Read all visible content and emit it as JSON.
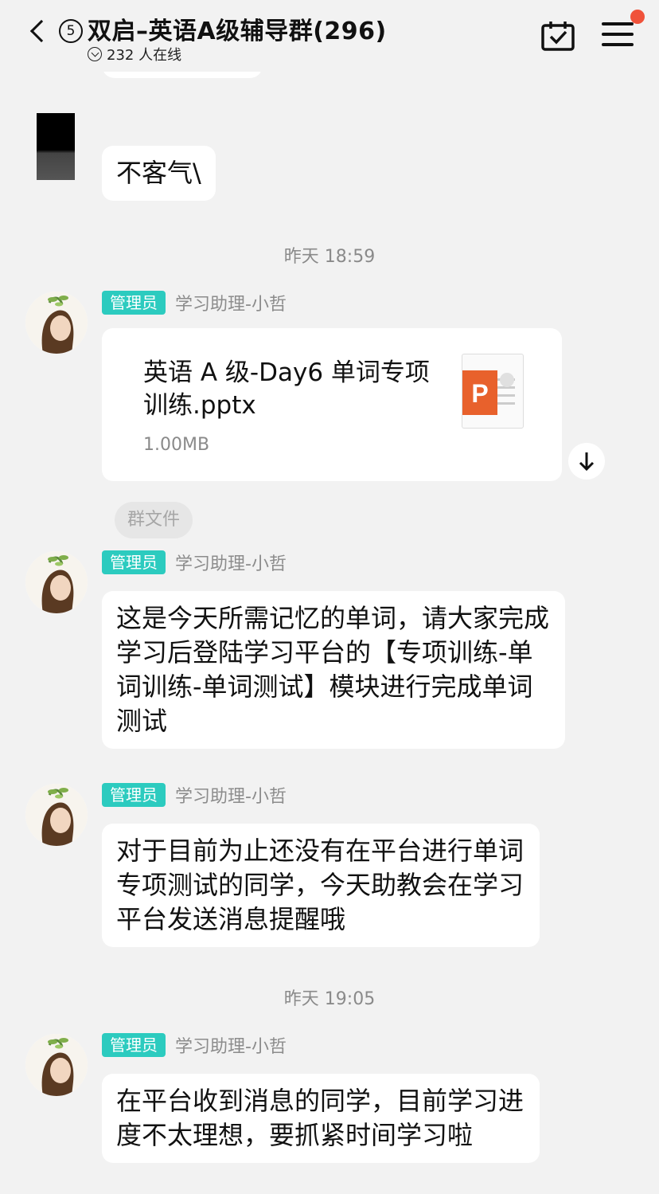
{
  "header": {
    "unread_count": "5",
    "group_title": "双启–英语A级辅导群(296)",
    "online_text": "232 人在线"
  },
  "messages": {
    "m1_text": "不客气\\",
    "time1": "昨天 18:59",
    "admin_badge": "管理员",
    "sender_name": "学习助理-小哲",
    "file_name": "英语 A 级-Day6 单词专项训练.pptx",
    "file_size": "1.00MB",
    "file_tag": "群文件",
    "m2_text": "这是今天所需记忆的单词，请大家完成学习后登陆学习平台的【专项训练-单词训练-单词测试】模块进行完成单词测试",
    "m3_text": "对于目前为止还没有在平台进行单词专项测试的同学，今天助教会在学习平台发送消息提醒哦",
    "time2": "昨天 19:05",
    "m4_text": "在平台收到消息的同学，目前学习进度不太理想，要抓紧时间学习啦"
  },
  "colors": {
    "admin_badge_bg": "#2ccbbf",
    "notification_dot": "#f0523a",
    "ppt_orange": "#e8612c"
  },
  "icons": [
    "back-chevron-icon",
    "calendar-check-icon",
    "menu-icon",
    "online-status-icon",
    "powerpoint-file-icon",
    "download-arrow-icon"
  ]
}
